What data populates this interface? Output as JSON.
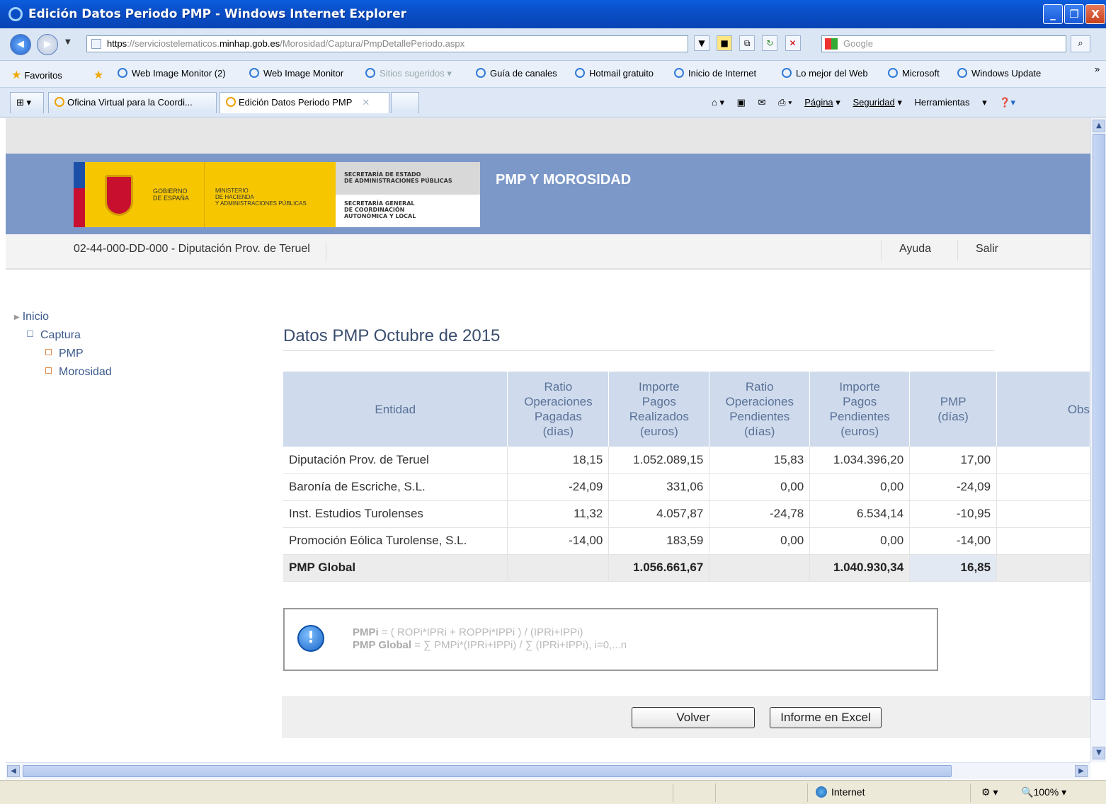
{
  "window": {
    "title": "Edición Datos Periodo PMP - Windows Internet Explorer",
    "minimize": "_",
    "maximize": "❐",
    "close": "X"
  },
  "address": {
    "scheme": "https",
    "rest1": "://serviciostelematicos.",
    "domain": "minhap.gob.es",
    "path": "/Morosidad/Captura/PmpDetallePeriodo.aspx",
    "search_placeholder": "Google"
  },
  "favorites": {
    "label": "Favoritos",
    "items": [
      "Web Image Monitor (2)",
      "Web Image Monitor",
      "Sitios sugeridos ▾",
      "Guía de canales",
      "Hotmail gratuito",
      "Inicio de Internet",
      "Lo mejor del Web",
      "Microsoft",
      "Windows Update"
    ]
  },
  "tabs": [
    {
      "label": "Oficina Virtual para la Coordi..."
    },
    {
      "label": "Edición Datos Periodo PMP"
    }
  ],
  "commandbar": {
    "page": "Página",
    "security": "Seguridad",
    "tools": "Herramientas"
  },
  "banner": {
    "gob_line1": "GOBIERNO",
    "gob_line2": "DE ESPAÑA",
    "min_line1": "MINISTERIO",
    "min_line2": "DE HACIENDA",
    "min_line3": "Y ADMINISTRACIONES PÚBLICAS",
    "sec1_line1": "SECRETARÍA DE ESTADO",
    "sec1_line2": "DE ADMINISTRACIONES PÚBLICAS",
    "sec2_line1": "SECRETARÍA GENERAL",
    "sec2_line2": "DE COORDINACIÓN",
    "sec2_line3": "AUTONÓMICA Y LOCAL",
    "app_title": "PMP Y MOROSIDAD"
  },
  "userbar": {
    "entity": "02-44-000-DD-000 - Diputación Prov. de Teruel",
    "help": "Ayuda",
    "logout": "Salir"
  },
  "nav": {
    "home": "Inicio",
    "capture": "Captura",
    "pmp": "PMP",
    "morosidad": "Morosidad"
  },
  "main": {
    "title": "Datos PMP Octubre de 2015"
  },
  "table": {
    "headers": {
      "entity": "Entidad",
      "rop_1": "Ratio",
      "rop_2": "Operaciones",
      "rop_3": "Pagadas",
      "rop_4": "(días)",
      "ipr_1": "Importe",
      "ipr_2": "Pagos",
      "ipr_3": "Realizados",
      "ipr_4": "(euros)",
      "ropp_1": "Ratio",
      "ropp_2": "Operaciones",
      "ropp_3": "Pendientes",
      "ropp_4": "(días)",
      "ipp_1": "Importe",
      "ipp_2": "Pagos",
      "ipp_3": "Pendientes",
      "ipp_4": "(euros)",
      "pmp_1": "PMP",
      "pmp_2": "(días)",
      "obs": "Obs"
    },
    "rows": [
      {
        "entity": "Diputación Prov. de Teruel",
        "rop": "18,15",
        "ipr": "1.052.089,15",
        "ropp": "15,83",
        "ipp": "1.034.396,20",
        "pmp": "17,00"
      },
      {
        "entity": "Baronía de Escriche, S.L.",
        "rop": "-24,09",
        "ipr": "331,06",
        "ropp": "0,00",
        "ipp": "0,00",
        "pmp": "-24,09"
      },
      {
        "entity": "Inst. Estudios Turolenses",
        "rop": "11,32",
        "ipr": "4.057,87",
        "ropp": "-24,78",
        "ipp": "6.534,14",
        "pmp": "-10,95"
      },
      {
        "entity": "Promoción Eólica Turolense, S.L.",
        "rop": "-14,00",
        "ipr": "183,59",
        "ropp": "0,00",
        "ipp": "0,00",
        "pmp": "-14,00"
      }
    ],
    "global": {
      "label": "PMP Global",
      "ipr": "1.056.661,67",
      "ipp": "1.040.930,34",
      "pmp": "16,85"
    }
  },
  "info": {
    "f1_label": "PMPi",
    "f1_text": " = ( ROPi*IPRi + ROPPi*IPPi ) / (IPRi+IPPi)",
    "f2_label": "PMP Global",
    "f2_text": " = ∑ PMPi*(IPRi+IPPi) / ∑ (IPRi+IPPi), i=0,...n"
  },
  "buttons": {
    "back": "Volver",
    "excel": "Informe en Excel"
  },
  "status": {
    "zone": "Internet",
    "zoom": "100%"
  }
}
